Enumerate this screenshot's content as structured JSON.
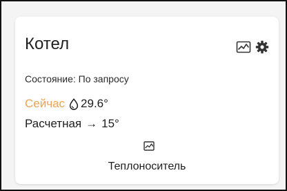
{
  "card": {
    "title": "Котел",
    "state_label": "Состояние:",
    "state_value": "По запросу",
    "now_label": "Сейчас",
    "now_value": "29.6°",
    "target_label": "Расчетная",
    "target_arrow": "→",
    "target_value": "15°",
    "footer_label": "Теплоноситель"
  },
  "icons": {
    "chart": "chart-icon",
    "settings": "gear-icon",
    "drop": "water-drop-icon"
  },
  "colors": {
    "accent": "#f1a24f",
    "text": "#1e1e1e"
  }
}
